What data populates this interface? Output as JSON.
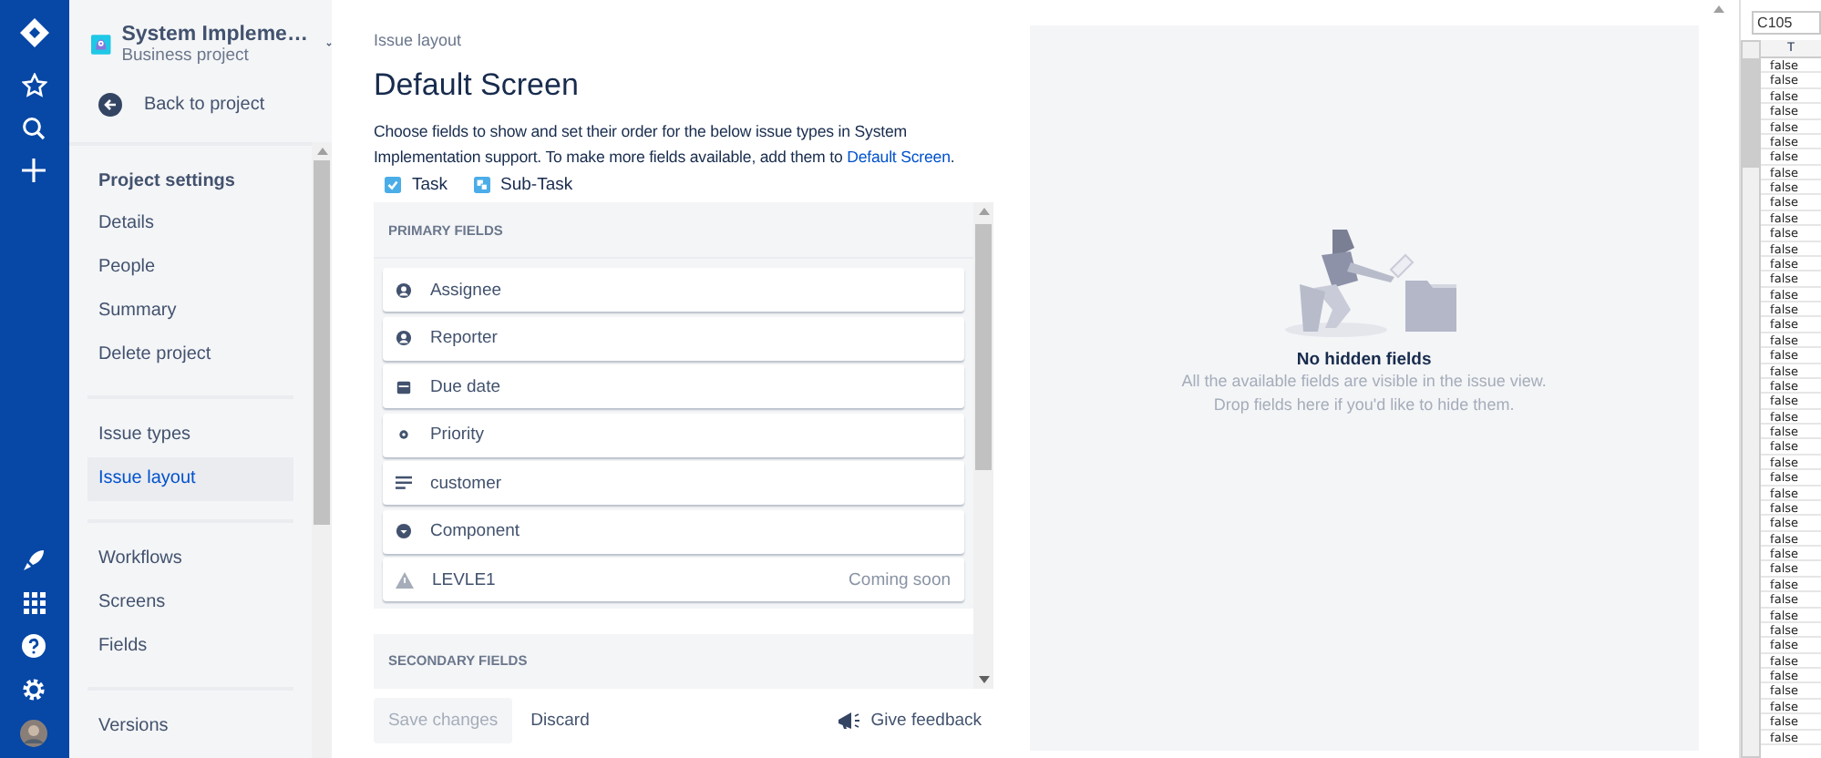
{
  "project": {
    "name": "System Impleme…",
    "type": "Business project"
  },
  "back": {
    "label": "Back to project"
  },
  "sidebar": {
    "sections": [
      {
        "heading": "Project settings",
        "items": [
          {
            "label": "Details",
            "selected": false
          },
          {
            "label": "People",
            "selected": false
          },
          {
            "label": "Summary",
            "selected": false
          },
          {
            "label": "Delete project",
            "selected": false
          }
        ]
      },
      {
        "items": [
          {
            "label": "Issue types",
            "selected": false
          },
          {
            "label": "Issue layout",
            "selected": true
          }
        ]
      },
      {
        "items": [
          {
            "label": "Workflows",
            "selected": false
          },
          {
            "label": "Screens",
            "selected": false
          },
          {
            "label": "Fields",
            "selected": false
          }
        ]
      },
      {
        "items": [
          {
            "label": "Versions",
            "selected": false
          }
        ]
      }
    ]
  },
  "breadcrumb": "Issue layout",
  "title": "Default Screen",
  "description": {
    "text": "Choose fields to show and set their order for the below issue types in System Implementation support. To make more fields available, add them to ",
    "link": "Default Screen",
    "end": "."
  },
  "issue_types": [
    {
      "label": "Task",
      "kind": "task"
    },
    {
      "label": "Sub-Task",
      "kind": "subtask"
    }
  ],
  "primary_fields": {
    "heading": "PRIMARY FIELDS",
    "fields": [
      {
        "label": "Assignee",
        "kind": "person"
      },
      {
        "label": "Reporter",
        "kind": "person"
      },
      {
        "label": "Due date",
        "kind": "calendar"
      },
      {
        "label": "Priority",
        "kind": "dot"
      },
      {
        "label": "customer",
        "kind": "text"
      },
      {
        "label": "Component",
        "kind": "component"
      },
      {
        "label": "LEVLE1",
        "kind": "warning",
        "badge": "Coming soon"
      }
    ]
  },
  "secondary_fields": {
    "heading": "SECONDARY FIELDS"
  },
  "buttons": [
    {
      "label": "Save changes",
      "kind": "save",
      "disabled": true
    },
    {
      "label": "Discard",
      "kind": "discard",
      "disabled": false
    }
  ],
  "feedback": "Give feedback",
  "hidden_panel": {
    "title": "No hidden fields",
    "lines": [
      "All the available fields are visible in the issue view.",
      "Drop fields here if you'd like to hide them."
    ]
  },
  "spreadsheet": {
    "cell_ref": "C105",
    "column": "T",
    "cells": [
      "false",
      "false",
      "false",
      "false",
      "false",
      "false",
      "false",
      "false",
      "false",
      "false",
      "false",
      "false",
      "false",
      "false",
      "false",
      "false",
      "false",
      "false",
      "false",
      "false",
      "false",
      "false",
      "false",
      "false",
      "false",
      "false",
      "false",
      "false",
      "false",
      "false",
      "false",
      "false",
      "false",
      "false",
      "false",
      "false",
      "false",
      "false",
      "false",
      "false",
      "false",
      "false",
      "false",
      "false",
      "false"
    ]
  }
}
